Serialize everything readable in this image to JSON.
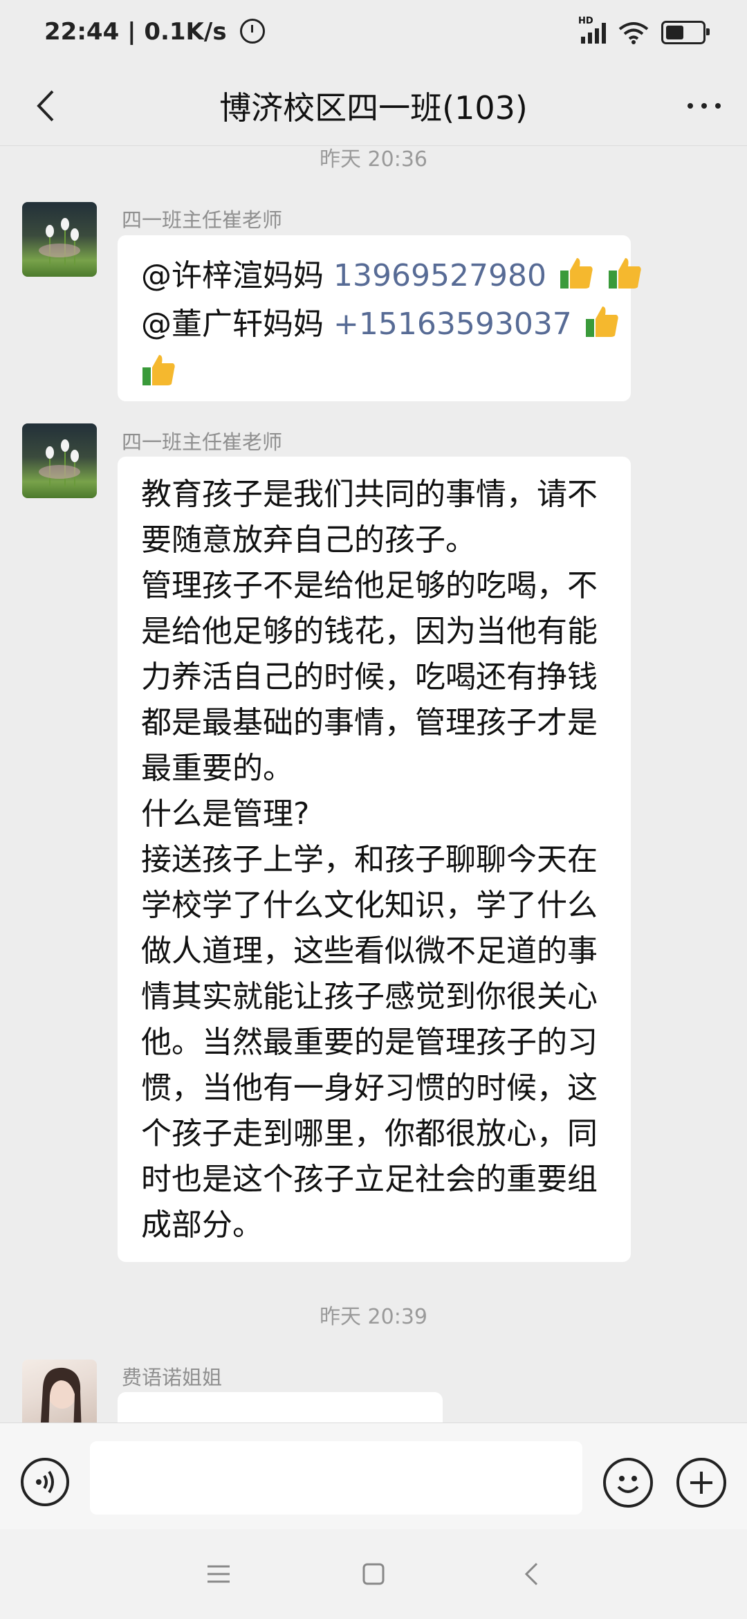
{
  "status_bar": {
    "time_speed": "22:44 | 0.1K/s",
    "hd_label": "HD",
    "battery_level": 0.5,
    "icons": [
      "alarm-icon",
      "signal-icon",
      "wifi-icon",
      "battery-icon"
    ]
  },
  "header": {
    "title": "博济校区四一班(103)",
    "back_icon": "chevron-left-icon",
    "more_icon": "more-dots-icon"
  },
  "timestamps": [
    "昨天 20:36",
    "昨天 20:39"
  ],
  "messages": [
    {
      "sender": "四一班主任崔老师",
      "avatar": "flower-avatar",
      "mentions": [
        {
          "name": "@许梓渲妈妈 ",
          "phone": "13969527980"
        },
        {
          "name": "@董广轩妈妈 ",
          "phone": "+15163593037"
        }
      ],
      "emoji": "thumbs-up-icon"
    },
    {
      "sender": "四一班主任崔老师",
      "avatar": "flower-avatar",
      "lines": [
        "教育孩子是我们共同的事情，请不",
        "要随意放弃自己的孩子。",
        "管理孩子不是给他足够的吃喝，不",
        "是给他足够的钱花，因为当他有能",
        "力养活自己的时候，吃喝还有挣钱",
        "都是最基础的事情，管理孩子才是",
        "最重要的。",
        "什么是管理?",
        "接送孩子上学，和孩子聊聊今天在",
        "学校学了什么文化知识，学了什么",
        "做人道理，这些看似微不足道的事",
        "情其实就能让孩子感觉到你很关心",
        "他。当然最重要的是管理孩子的习",
        "惯，当他有一身好习惯的时候，这",
        "个孩子走到哪里，你都很放心，同",
        "时也是这个孩子立足社会的重要组",
        "成部分。"
      ]
    },
    {
      "sender": "费语诺姐姐",
      "avatar": "girl-avatar",
      "type": "voice"
    }
  ],
  "input_bar": {
    "voice_icon": "voice-icon",
    "emoji_icon": "emoji-icon",
    "plus_icon": "plus-icon",
    "value": ""
  },
  "system_nav": [
    "menu-icon",
    "home-icon",
    "back-icon"
  ]
}
